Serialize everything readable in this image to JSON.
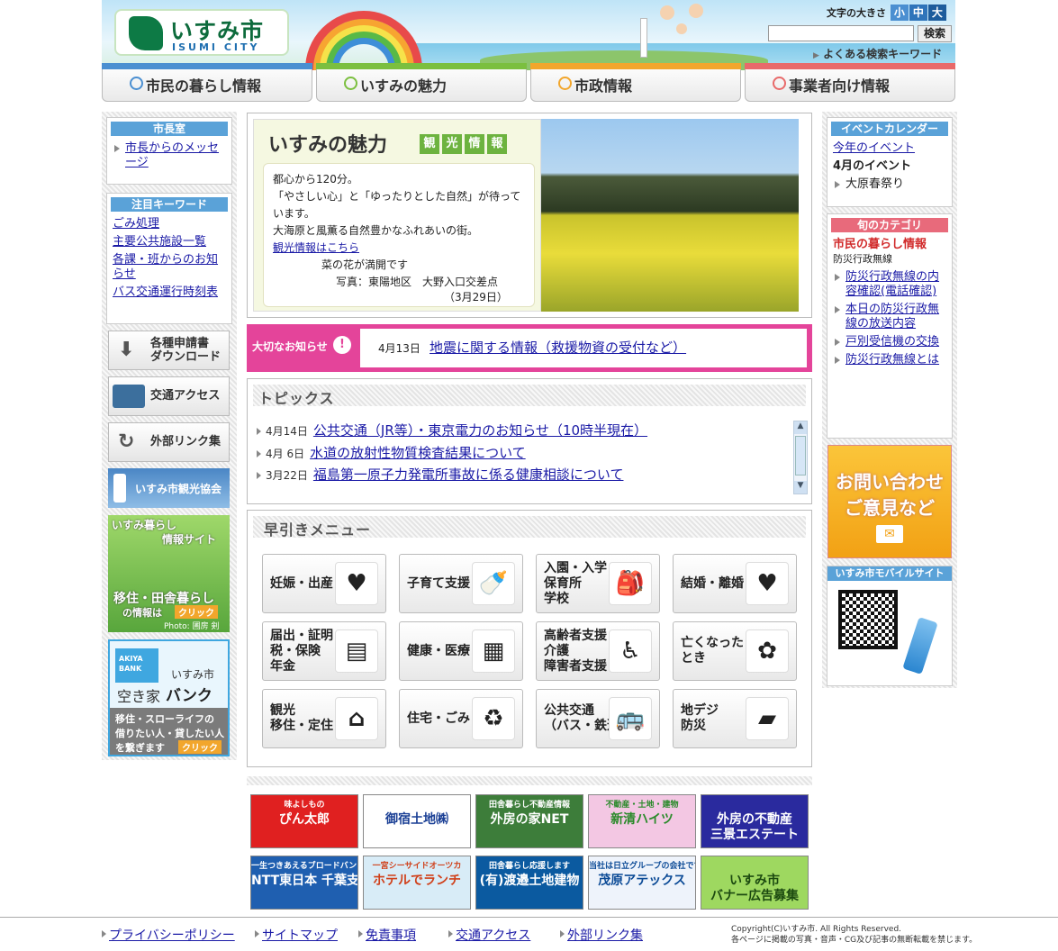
{
  "header": {
    "logo_ja": "いすみ市",
    "logo_en": "ISUMI CITY",
    "font_size_label": "文字の大きさ",
    "font_sizes": [
      "小",
      "中",
      "大"
    ],
    "search_button": "検索",
    "faq_keywords": "よくある検索キーワード"
  },
  "nav": [
    {
      "label": "市民の暮らし情報",
      "color": "#4b8fd1"
    },
    {
      "label": "いすみの魅力",
      "color": "#7bbf3f"
    },
    {
      "label": "市政情報",
      "color": "#f2a62c"
    },
    {
      "label": "事業者向け情報",
      "color": "#e86a6a"
    }
  ],
  "left": {
    "mayor_title": "市長室",
    "mayor_link": "市長からのメッセージ",
    "kw_title": "注目キーワード",
    "keywords": [
      "ごみ処理",
      "主要公共施設一覧",
      "各課・班からのお知らせ",
      "バス交通運行時刻表"
    ],
    "btn_download": "各種申請書\nダウンロード",
    "btn_access": "交通アクセス",
    "btn_links": "外部リンク集",
    "tourism_banner": "いすみ市観光協会",
    "life_banner_top1": "いすみ暮らし",
    "life_banner_top2": "情報サイト",
    "life_banner_bottom1": "移住・田舎暮らし",
    "life_banner_bottom2": "の情報は",
    "life_banner_click": "クリック",
    "life_banner_photo": "Photo: 圃房 剣",
    "akiya_tag1": "AKIYA",
    "akiya_tag2": "BANK",
    "akiya_city": "いすみ市",
    "akiya_title1": "空き家",
    "akiya_title2": "バンク",
    "akiya_desc1": "移住・スローライフの",
    "akiya_desc2": "借りたい人・貸したい人",
    "akiya_desc3": "を繋ぎます",
    "akiya_click": "クリック"
  },
  "feature": {
    "title": "いすみの魅力",
    "tags": [
      "観",
      "光",
      "情",
      "報"
    ],
    "text1": "都心から120分。",
    "text2": "「やさしい心」と「ゆったりとした自然」が待っています。",
    "text3": "大海原と風薫る自然豊かなふれあいの街。",
    "link": "観光情報はこちら",
    "caption1": "菜の花が満開です",
    "caption2": "写真：東陽地区　大野入口交差点",
    "caption3": "（3月29日）"
  },
  "notice": {
    "label": "大切なお知らせ",
    "date": "4月13日",
    "text": "地震に関する情報（救援物資の受付など）"
  },
  "topics": {
    "title": "トピックス",
    "items": [
      {
        "date": "4月14日",
        "text": "公共交通（JR等）・東京電力のお知らせ（10時半現在）"
      },
      {
        "date": "4月 6日",
        "text": "水道の放射性物質検査結果について"
      },
      {
        "date": "3月22日",
        "text": "福島第一原子力発電所事故に係る健康相談について"
      }
    ]
  },
  "quick_menu": {
    "title": "早引きメニュー",
    "items": [
      {
        "label": "妊娠・出産",
        "icon": "♥"
      },
      {
        "label": "子育て支援",
        "icon": "🍼"
      },
      {
        "label": "入園・入学\n保育所\n学校",
        "icon": "🎒"
      },
      {
        "label": "結婚・離婚",
        "icon": "♥"
      },
      {
        "label": "届出・証明\n税・保険\n年金",
        "icon": "▤"
      },
      {
        "label": "健康・医療",
        "icon": "▦"
      },
      {
        "label": "高齢者支援\n介護\n障害者支援",
        "icon": "♿"
      },
      {
        "label": "亡くなった\nとき",
        "icon": "✿"
      },
      {
        "label": "観光\n移住・定住",
        "icon": "⌂"
      },
      {
        "label": "住宅・ごみ",
        "icon": "♻"
      },
      {
        "label": "公共交通\n（バス・鉄道）",
        "icon": "🚌"
      },
      {
        "label": "地デジ\n防災",
        "icon": "▰"
      }
    ]
  },
  "ads": [
    {
      "text": "ぴん太郎",
      "sub": "味よしもの",
      "bg": "#e02020",
      "fg": "#ffffff"
    },
    {
      "text": "御宿土地㈱",
      "sub": "",
      "bg": "#ffffff",
      "fg": "#1a3f95"
    },
    {
      "text": "外房の家NET",
      "sub": "田舎暮らし不動産情報",
      "bg": "#3d7d3a",
      "fg": "#ffffff"
    },
    {
      "text": "新清ハイツ",
      "sub": "不動産・土地・建物",
      "bg": "#f3c7e3",
      "fg": "#2a8a2a"
    },
    {
      "text": "外房の不動産\n三景エステート",
      "sub": "",
      "bg": "#2a2a9e",
      "fg": "#ffffff"
    },
    {
      "text": "NTT東日本 千葉支店",
      "sub": "一生つきあえるブロードバンド",
      "bg": "#1f5fb0",
      "fg": "#ffffff"
    },
    {
      "text": "ホテルでランチ",
      "sub": "一宮シーサイドオーツカ",
      "bg": "#d8ecf7",
      "fg": "#d0401a"
    },
    {
      "text": "(有)渡邉土地建物",
      "sub": "田舎暮らし応援します",
      "bg": "#0b5aa0",
      "fg": "#ffffff"
    },
    {
      "text": "茂原アテックス",
      "sub": "当社は日立グループの会社です",
      "bg": "#eef3fb",
      "fg": "#0b4a96"
    },
    {
      "text": "いすみ市\nバナー広告募集",
      "sub": "",
      "bg": "#9ed860",
      "fg": "#1c4a10"
    }
  ],
  "right": {
    "event_title": "イベントカレンダー",
    "event_year": "今年のイベント",
    "event_month": "4月のイベント",
    "event_item": "大原春祭り",
    "cat_title": "旬のカテゴリ",
    "cat_head": "市民の暮らし情報",
    "cat_sub": "防災行政無線",
    "cat_items": [
      "防災行政無線の内容確認(電話確認)",
      "本日の防災行政無線の放送内容",
      "戸別受信機の交換",
      "防災行政無線とは"
    ],
    "contact1": "お問い合わせ",
    "contact2": "ご意見など",
    "mobile_title": "いすみ市モバイルサイト"
  },
  "footer": {
    "links": [
      "プライバシーポリシー",
      "サイトマップ",
      "免責事項",
      "交通アクセス",
      "外部リンク集"
    ],
    "copyright1": "Copyright(C)いすみ市. All Rights Reserved.",
    "copyright2": "各ページに掲載の写真・音声・CG及び記事の無断転載を禁じます。"
  }
}
